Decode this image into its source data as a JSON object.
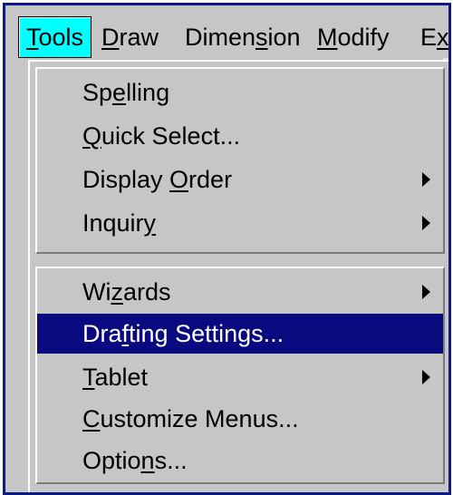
{
  "menubar": {
    "items": [
      {
        "pre": "",
        "key": "T",
        "post": "ools"
      },
      {
        "pre": "",
        "key": "D",
        "post": "raw"
      },
      {
        "pre": "Dimen",
        "key": "s",
        "post": "ion"
      },
      {
        "pre": "",
        "key": "M",
        "post": "odify"
      },
      {
        "pre": "E",
        "key": "x",
        "post": ""
      }
    ]
  },
  "menu": {
    "group1": [
      {
        "pre": "Sp",
        "key": "e",
        "post": "lling",
        "submenu": false
      },
      {
        "pre": "",
        "key": "Q",
        "post": "uick Select...",
        "submenu": false
      },
      {
        "pre": "Display ",
        "key": "O",
        "post": "rder",
        "submenu": true
      },
      {
        "pre": "Inquir",
        "key": "y",
        "post": "",
        "submenu": true
      }
    ],
    "group2": [
      {
        "pre": "Wi",
        "key": "z",
        "post": "ards",
        "submenu": true
      },
      {
        "pre": "Dra",
        "key": "f",
        "post": "ting Settings...",
        "submenu": false,
        "highlighted": true
      },
      {
        "pre": "",
        "key": "T",
        "post": "ablet",
        "submenu": true
      },
      {
        "pre": "",
        "key": "C",
        "post": "ustomize Menus...",
        "submenu": false
      },
      {
        "pre": "Optio",
        "key": "n",
        "post": "s...",
        "submenu": false
      }
    ]
  },
  "colors": {
    "menu_bg": "#c6c6c6",
    "active_menu_bg": "#00ffff",
    "highlight_bg": "#0a0a80",
    "frame_border": "#0b1a86"
  },
  "icons": {
    "submenu": "submenu-arrow-icon"
  }
}
